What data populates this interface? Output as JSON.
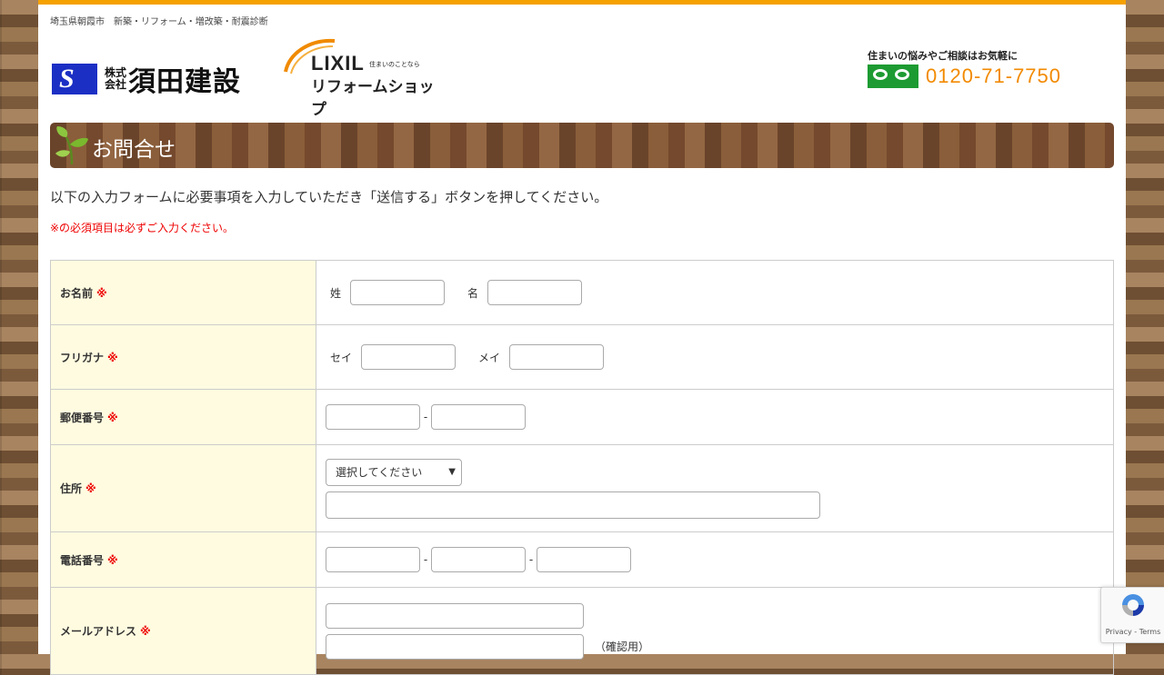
{
  "header": {
    "tagline": "埼玉県朝霞市　新築・リフォーム・増改築・耐震診断",
    "company_prefix": "株式\n会社",
    "company_name": "須田建設",
    "lixil_brand": "LIXIL",
    "lixil_tagline": "住まいのことなら",
    "lixil_shop": "リフォームショップ",
    "contact_note": "住まいの悩みやご相談はお気軽に",
    "phone": "0120-71-7750"
  },
  "page": {
    "title": "お問合せ",
    "intro": "以下の入力フォームに必要事項を入力していただき「送信する」ボタンを押してください。",
    "required_note": "※の必須項目は必ずご入力ください。",
    "required_mark": "※"
  },
  "form": {
    "name": {
      "label": "お名前",
      "last_label": "姓",
      "first_label": "名",
      "last_value": "",
      "first_value": ""
    },
    "furigana": {
      "label": "フリガナ",
      "sei_label": "セイ",
      "mei_label": "メイ",
      "sei_value": "",
      "mei_value": ""
    },
    "postal": {
      "label": "郵便番号",
      "separator": "-",
      "part1": "",
      "part2": ""
    },
    "address": {
      "label": "住所",
      "select_value": "選択してください",
      "line_value": ""
    },
    "phone": {
      "label": "電話番号",
      "separator": "-",
      "part1": "",
      "part2": "",
      "part3": ""
    },
    "email": {
      "label": "メールアドレス",
      "value": "",
      "confirm_value": "",
      "confirm_label": "（確認用）"
    }
  },
  "recaptcha": {
    "links": "Privacy - Terms"
  },
  "colors": {
    "accent": "#f5a100",
    "required": "#e00000",
    "label_bg": "#fffbe0",
    "phone": "#f28a00"
  }
}
